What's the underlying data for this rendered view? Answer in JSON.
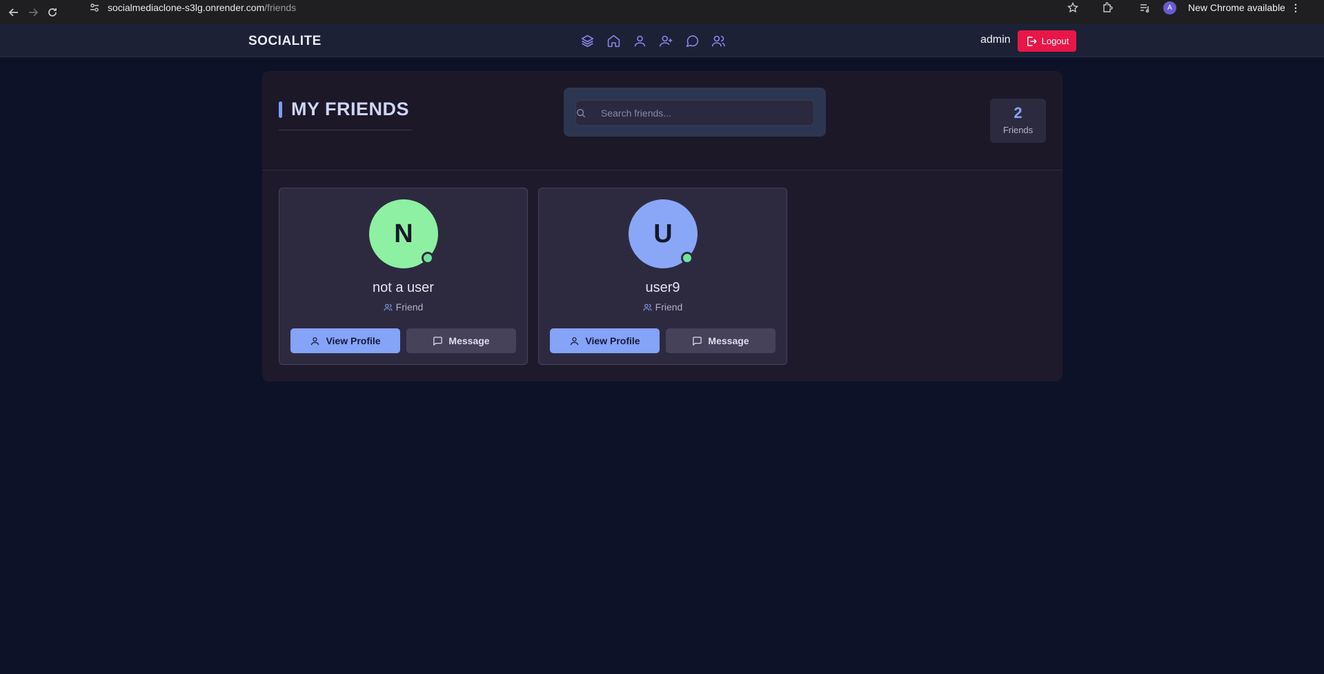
{
  "browser": {
    "url_host": "socialmediaclone-s3lg.onrender.com",
    "url_path": "/friends",
    "profile_initial": "A",
    "update_label": "New Chrome available"
  },
  "header": {
    "brand": "SOCIALITE",
    "nav_icons": [
      "layers-icon",
      "home-icon",
      "user-icon",
      "user-plus-icon",
      "message-icon",
      "users-icon"
    ],
    "username": "admin",
    "logout_label": "Logout",
    "accent": "#8f86ea",
    "logout_color": "#e81748"
  },
  "page": {
    "title": "MY FRIENDS",
    "search_placeholder": "Search friends...",
    "count": "2",
    "count_label": "Friends"
  },
  "friends": [
    {
      "initial": "N",
      "name": "not a user",
      "tag": "Friend",
      "avatar_color": "#8ef0a2",
      "online": true
    },
    {
      "initial": "U",
      "name": "user9",
      "tag": "Friend",
      "avatar_color": "#8aa6f7",
      "online": true
    }
  ],
  "actions": {
    "view_profile": "View Profile",
    "message": "Message"
  }
}
